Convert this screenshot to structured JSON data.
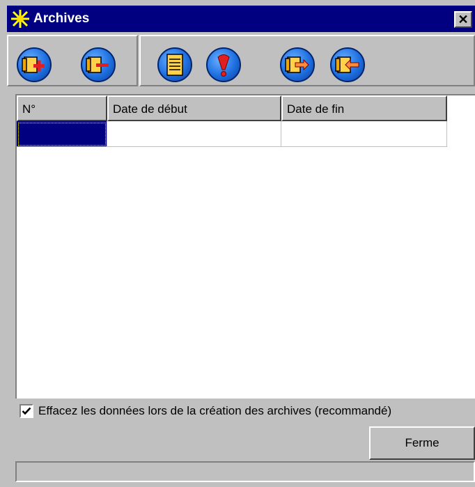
{
  "window": {
    "title": "Archives",
    "close_label": "✕"
  },
  "toolbar": {
    "buttons": [
      {
        "name": "add-archive-icon"
      },
      {
        "name": "remove-archive-icon"
      },
      {
        "name": "document-icon"
      },
      {
        "name": "alert-icon"
      },
      {
        "name": "export-archive-icon"
      },
      {
        "name": "import-archive-icon"
      }
    ]
  },
  "grid": {
    "columns": [
      "N°",
      "Date de début",
      "Date de fin"
    ],
    "rows": [
      [
        "",
        "",
        ""
      ]
    ]
  },
  "options": {
    "erase_checkbox_checked": true,
    "erase_label": "Effacez les données lors de la création des archives (recommandé)"
  },
  "buttons": {
    "close_label": "Ferme"
  },
  "status": {
    "text": ""
  }
}
